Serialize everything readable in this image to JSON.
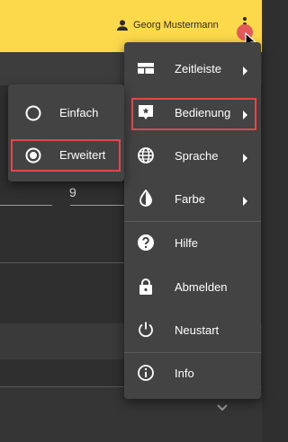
{
  "header": {
    "user_name": "Georg Mustermann",
    "user_icon": "account-icon",
    "more_icon": "more-vert-icon"
  },
  "background": {
    "field_value": "9"
  },
  "menu": {
    "items": [
      {
        "label": "Zeitleiste",
        "icon": "timeline-icon",
        "submenu": true
      },
      {
        "label": "Bedienung",
        "icon": "touch-app-icon",
        "submenu": true
      },
      {
        "label": "Sprache",
        "icon": "globe-icon",
        "submenu": true
      },
      {
        "label": "Farbe",
        "icon": "drop-icon",
        "submenu": true
      },
      {
        "label": "Hilfe",
        "icon": "help-icon",
        "submenu": false
      },
      {
        "label": "Abmelden",
        "icon": "lock-icon",
        "submenu": false
      },
      {
        "label": "Neustart",
        "icon": "power-icon",
        "submenu": false
      },
      {
        "label": "Info",
        "icon": "info-icon",
        "submenu": false
      }
    ]
  },
  "submenu": {
    "items": [
      {
        "label": "Einfach",
        "selected": false
      },
      {
        "label": "Erweitert",
        "selected": true
      }
    ]
  },
  "colors": {
    "topbar": "#fcd94a",
    "menu_bg": "#434343",
    "highlight": "#e0484e"
  }
}
